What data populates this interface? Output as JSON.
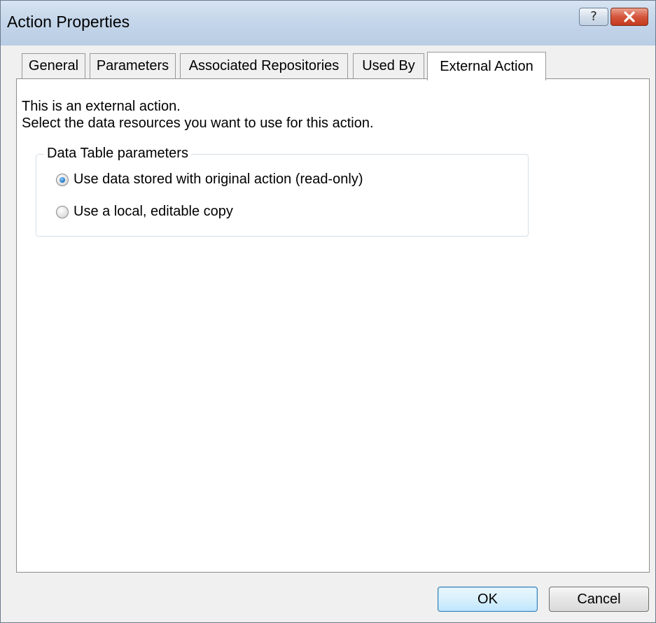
{
  "window": {
    "title": "Action Properties",
    "help_glyph": "?",
    "close_icon": "close-icon",
    "colors": {
      "close_button": "#c43b1f",
      "title_bar": "#c4d6ea"
    }
  },
  "tabs": [
    {
      "label": "General",
      "active": false
    },
    {
      "label": "Parameters",
      "active": false
    },
    {
      "label": "Associated Repositories",
      "active": false
    },
    {
      "label": "Used By",
      "active": false
    },
    {
      "label": "External Action",
      "active": true
    }
  ],
  "content": {
    "line1": "This is an external action.",
    "line2": "Select the data resources you want to use for this action.",
    "group": {
      "title": "Data Table parameters",
      "options": [
        {
          "label": "Use data stored with original action (read-only)",
          "checked": true
        },
        {
          "label": "Use a local, editable copy",
          "checked": false
        }
      ]
    }
  },
  "buttons": {
    "ok": "OK",
    "cancel": "Cancel"
  }
}
